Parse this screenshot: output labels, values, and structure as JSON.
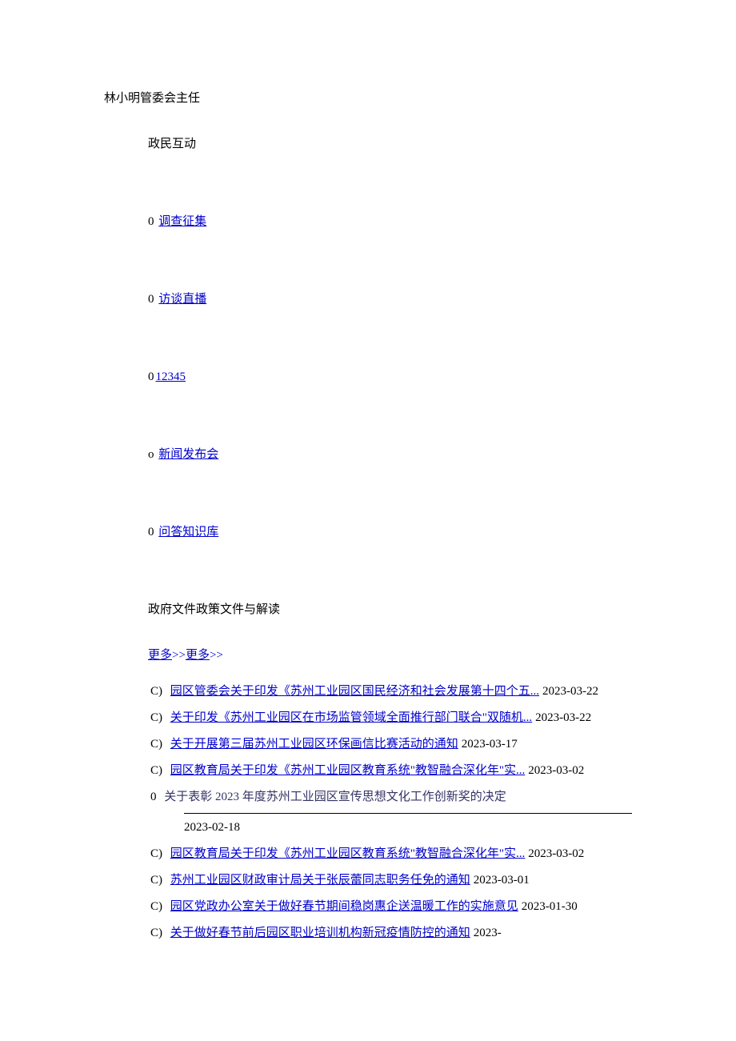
{
  "leader": {
    "name": "林小明",
    "title": "管委会主任"
  },
  "interaction": {
    "title": "政民互动",
    "items": [
      {
        "bullet": "0",
        "label": "调查征集"
      },
      {
        "bullet": "0",
        "label": "访谈直播"
      },
      {
        "bullet": "0",
        "label": "12345"
      },
      {
        "bullet": "o",
        "label": "新闻发布会"
      },
      {
        "bullet": "0",
        "label": "问答知识库"
      }
    ]
  },
  "tabs": {
    "t1": "政府文件",
    "t2": "政策文件与解读"
  },
  "more": {
    "label": "更多",
    "arrows": ">>"
  },
  "docs": {
    "list1": [
      {
        "bullet": "C)",
        "title": "园区管委会关于印发《苏州工业园区国民经济和社会发展第十四个五...",
        "date": "2023-03-22"
      },
      {
        "bullet": "C)",
        "title": "关于印发《苏州工业园区在市场监管领域全面推行部门联合\"双随机...",
        "date": "2023-03-22"
      },
      {
        "bullet": "C)",
        "title": "关于开展第三届苏州工业园区环保画信比赛活动的通知",
        "date": "2023-03-17"
      },
      {
        "bullet": "C)",
        "title": "园区教育局关于印发《苏州工业园区教育系统\"教智融合深化年\"实...",
        "date": "2023-03-02"
      }
    ],
    "highlight": {
      "bullet": "0",
      "title": "关于表彰 2023 年度苏州工业园区宣传思想文化工作创新奖的决定",
      "date": "2023-02-18"
    },
    "list2": [
      {
        "bullet": "C)",
        "title": "园区教育局关于印发《苏州工业园区教育系统\"教智融合深化年\"实...",
        "date": "2023-03-02"
      },
      {
        "bullet": "C)",
        "title": "苏州工业园区财政审计局关于张辰蕾同志职务任免的通知",
        "date": "2023-03-01"
      },
      {
        "bullet": "C)",
        "title": "园区党政办公室关于做好春节期间稳岗惠企送温暖工作的实施意见",
        "date": "2023-01-30"
      },
      {
        "bullet": "C)",
        "title": "关于做好春节前后园区职业培训机构新冠疫情防控的通知",
        "date": "2023-"
      }
    ]
  }
}
